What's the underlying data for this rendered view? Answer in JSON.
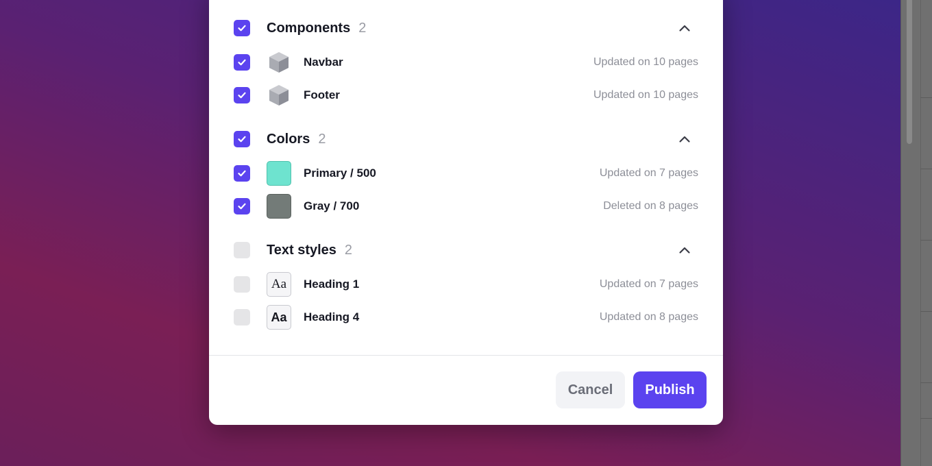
{
  "colors": {
    "accent": "#5b43ef",
    "primary_500": "#6ee3cf",
    "gray_700": "#737b78"
  },
  "groups": [
    {
      "title": "Components",
      "count": "2",
      "checked": true,
      "items": [
        {
          "label": "Navbar",
          "status": "Updated on 10 pages",
          "icon": "component-cube-icon",
          "checked": true
        },
        {
          "label": "Footer",
          "status": "Updated on 10 pages",
          "icon": "component-cube-icon",
          "checked": true
        }
      ]
    },
    {
      "title": "Colors",
      "count": "2",
      "checked": true,
      "items": [
        {
          "label": "Primary / 500",
          "status": "Updated on 7 pages",
          "icon": "color-swatch",
          "checked": true
        },
        {
          "label": "Gray / 700",
          "status": "Deleted on 8 pages",
          "icon": "color-swatch",
          "checked": true
        }
      ]
    },
    {
      "title": "Text styles",
      "count": "2",
      "checked": false,
      "items": [
        {
          "label": "Heading 1",
          "status": "Updated on 7 pages",
          "icon": "text-style-icon",
          "glyph": "Aa",
          "checked": false
        },
        {
          "label": "Heading 4",
          "status": "Updated on 8 pages",
          "icon": "text-style-icon",
          "glyph": "Aa",
          "checked": false
        }
      ]
    }
  ],
  "footer": {
    "cancel_label": "Cancel",
    "publish_label": "Publish"
  }
}
